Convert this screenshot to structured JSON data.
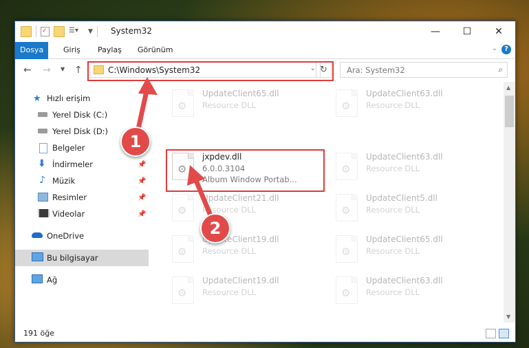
{
  "window": {
    "title": "System32",
    "controls": {
      "minimize": "—",
      "maximize": "☐",
      "close": "✕"
    }
  },
  "ribbon": {
    "tabs": [
      "Dosya",
      "Giriş",
      "Paylaş",
      "Görünüm"
    ],
    "help": "?"
  },
  "navigation": {
    "address": "C:\\Windows\\System32",
    "search_placeholder": "Ara: System32"
  },
  "sidebar": {
    "items": [
      {
        "label": "Hızlı erişim",
        "icon": "star-icon",
        "pinned": false
      },
      {
        "label": "Yerel Disk (C:)",
        "icon": "drive-icon",
        "pinned": false
      },
      {
        "label": "Yerel Disk (D:)",
        "icon": "drive-icon",
        "pinned": false
      },
      {
        "label": "Belgeler",
        "icon": "documents-icon",
        "pinned": true
      },
      {
        "label": "İndirmeler",
        "icon": "download-icon",
        "pinned": true
      },
      {
        "label": "Müzik",
        "icon": "music-icon",
        "pinned": true
      },
      {
        "label": "Resimler",
        "icon": "pictures-icon",
        "pinned": true
      },
      {
        "label": "Videolar",
        "icon": "video-icon",
        "pinned": true
      },
      {
        "label": "OneDrive",
        "icon": "cloud-icon",
        "pinned": false
      },
      {
        "label": "Bu bilgisayar",
        "icon": "computer-icon",
        "pinned": false
      },
      {
        "label": "Ağ",
        "icon": "network-icon",
        "pinned": false
      }
    ]
  },
  "files": [
    {
      "name": "UpdateClient65.dll",
      "line2": "Resource DLL",
      "line3": ""
    },
    {
      "name": "UpdateClient63.dll",
      "line2": "Resource DLL",
      "line3": ""
    },
    {
      "name": "jxpdev.dll",
      "line2": "6.0.0.3104",
      "line3": "Album Window Portab..."
    },
    {
      "name": "UpdateClient63.dll",
      "line2": "Resource DLL",
      "line3": ""
    },
    {
      "name": "UpdateClient21.dll",
      "line2": "Resource DLL",
      "line3": ""
    },
    {
      "name": "UpdateClient5.dll",
      "line2": "Resource DLL",
      "line3": ""
    },
    {
      "name": "UpdateClient19.dll",
      "line2": "Resource DLL",
      "line3": ""
    },
    {
      "name": "UpdateClient65.dll",
      "line2": "Resource DLL",
      "line3": ""
    },
    {
      "name": "UpdateClient19.dll",
      "line2": "Resource DLL",
      "line3": ""
    },
    {
      "name": "UpdateClient63.dll",
      "line2": "Resource DLL",
      "line3": ""
    }
  ],
  "status": {
    "count": "191 öğe"
  },
  "callouts": {
    "one": "1",
    "two": "2"
  },
  "colors": {
    "accent": "#1979ca",
    "highlight": "#e03b3b"
  }
}
